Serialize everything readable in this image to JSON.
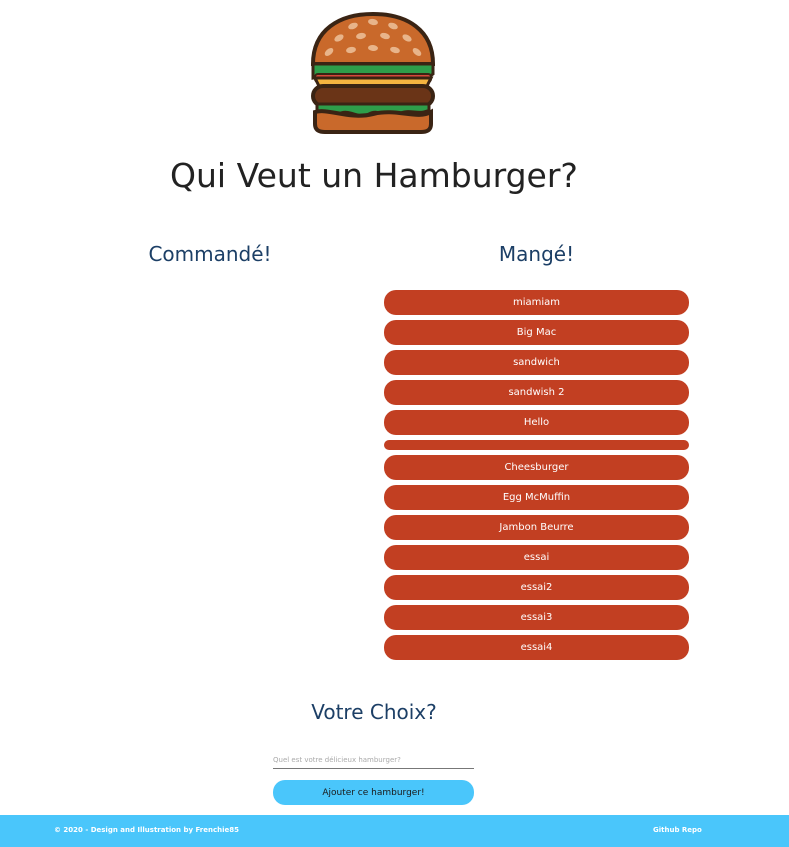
{
  "page": {
    "title": "Qui Veut un Hamburger?",
    "logo_icon": "hamburger-icon"
  },
  "ordered": {
    "heading": "Commandé!",
    "items": []
  },
  "eaten": {
    "heading": "Mangé!",
    "items": [
      "miamiam",
      "Big Mac",
      "sandwich",
      "sandwish 2",
      "Hello",
      "",
      "Cheesburger",
      "Egg McMuffin",
      "Jambon Beurre",
      "essai",
      "essai2",
      "essai3",
      "essai4"
    ]
  },
  "form": {
    "heading": "Votre Choix?",
    "input_placeholder": "Quel est votre délicieux hamburger?",
    "input_value": "",
    "button_label": "Ajouter ce hamburger!"
  },
  "footer": {
    "credit": "© 2020 - Design and Illustration by Frenchie85",
    "repo_link": "Github Repo"
  },
  "colors": {
    "item_background": "#c23f22",
    "accent": "#4ac6fb",
    "heading_blue": "#1c3f66"
  }
}
